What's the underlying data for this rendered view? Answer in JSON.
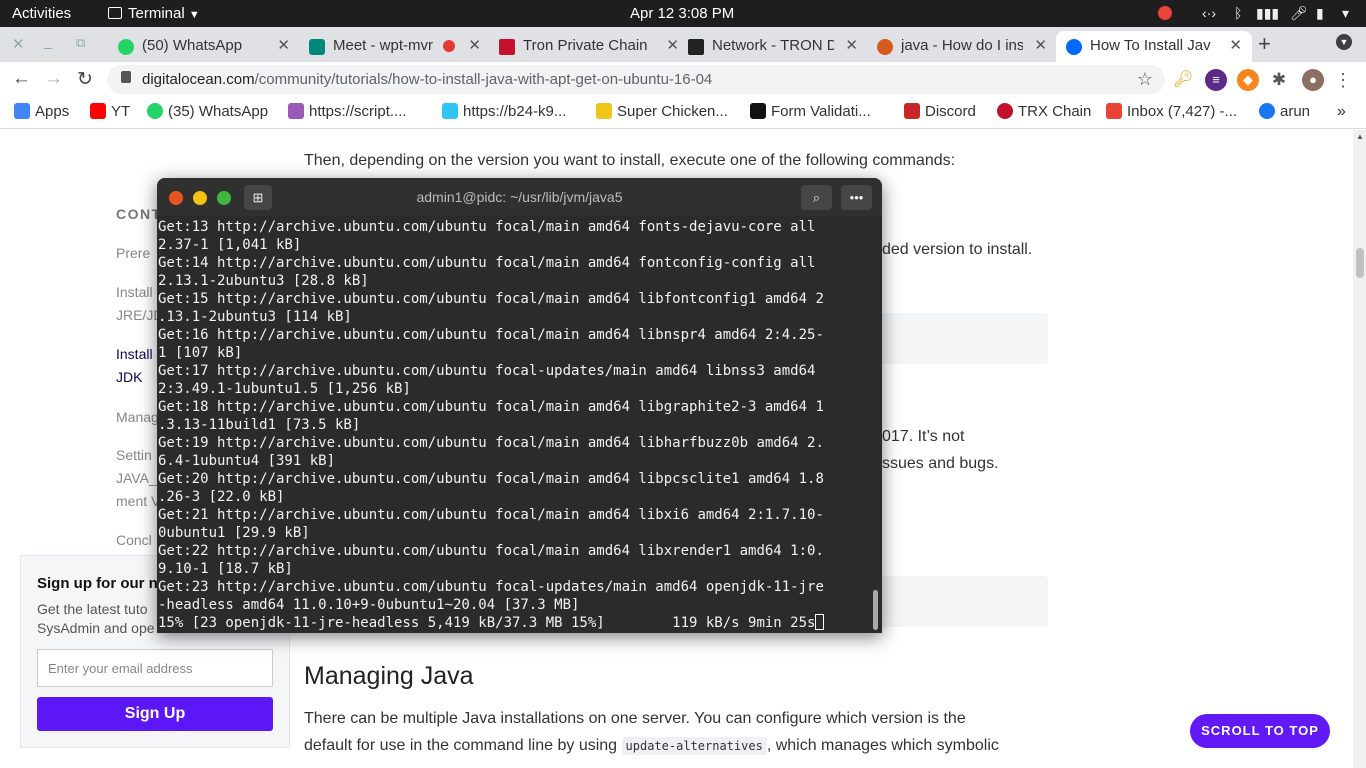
{
  "topbar": {
    "activities": "Activities",
    "app_menu": "Terminal",
    "clock": "Apr 12  3:08 PM"
  },
  "tabs": [
    {
      "title": "(50) WhatsApp",
      "color": "#25d366"
    },
    {
      "title": "Meet - wpt-mvr",
      "color": "#00897b"
    },
    {
      "title": "Tron Private Chain",
      "color": "#c3112d"
    },
    {
      "title": "Network - TRON D",
      "color": "#222222"
    },
    {
      "title": "java - How do I inst",
      "color": "#d65b1d"
    },
    {
      "title": "How To Install Jav",
      "color": "#0069ff"
    }
  ],
  "toolbar": {
    "url_domain": "digitalocean.com",
    "url_path": "/community/tutorials/how-to-install-java-with-apt-get-on-ubuntu-16-04"
  },
  "bookmarks": [
    {
      "label": "Apps",
      "color": "#4285f4"
    },
    {
      "label": "YT",
      "color": "#ff0000"
    },
    {
      "label": "(35) WhatsApp",
      "color": "#25d366"
    },
    {
      "label": "https://script....",
      "color": "#9b59b6"
    },
    {
      "label": "https://b24-k9...",
      "color": "#2fc6f6"
    },
    {
      "label": "Super Chicken...",
      "color": "#f0c419"
    },
    {
      "label": "Form Validati...",
      "color": "#111111"
    },
    {
      "label": "Discord",
      "color": "#7289da"
    },
    {
      "label": "TRX Chain",
      "color": "#c3112d"
    },
    {
      "label": "Inbox (7,427) -...",
      "color": "#ea4335"
    },
    {
      "label": "arun",
      "color": "#1877f2"
    }
  ],
  "page": {
    "intro": "Then, depending on the version you want to install, execute one of the following commands:",
    "frag1": "ded version to install.",
    "frag2": "017. It’s not",
    "frag3": "ssues and bugs.",
    "heading": "Managing Java",
    "para_line1": "There can be multiple Java installations on one server. You can configure which version is the",
    "para_line2a": "default for use in the command line by using",
    "para_code": "update-alternatives",
    "para_line2b": ", which manages which symbolic"
  },
  "sidebar": {
    "contents_label": "CONT",
    "items": [
      "Prere",
      "Install",
      "JRE/JD",
      "Install",
      "JDK",
      "Manag",
      "Settin",
      "JAVA_",
      "ment V",
      "Concl"
    ]
  },
  "signup": {
    "title": "Sign up for our n",
    "desc1": "Get the latest tuto",
    "desc2": "SysAdmin and ope",
    "email_placeholder": "Enter your email address",
    "button": "Sign Up"
  },
  "scroll_top": "SCROLL TO TOP",
  "terminal": {
    "title": "admin1@pidc: ~/usr/lib/jvm/java5",
    "lines": [
      "Get:13 http://archive.ubuntu.com/ubuntu focal/main amd64 fonts-dejavu-core all",
      "2.37-1 [1,041 kB]",
      "Get:14 http://archive.ubuntu.com/ubuntu focal/main amd64 fontconfig-config all",
      "2.13.1-2ubuntu3 [28.8 kB]",
      "Get:15 http://archive.ubuntu.com/ubuntu focal/main amd64 libfontconfig1 amd64 2",
      ".13.1-2ubuntu3 [114 kB]",
      "Get:16 http://archive.ubuntu.com/ubuntu focal/main amd64 libnspr4 amd64 2:4.25-",
      "1 [107 kB]",
      "Get:17 http://archive.ubuntu.com/ubuntu focal-updates/main amd64 libnss3 amd64",
      "2:3.49.1-1ubuntu1.5 [1,256 kB]",
      "Get:18 http://archive.ubuntu.com/ubuntu focal/main amd64 libgraphite2-3 amd64 1",
      ".3.13-11build1 [73.5 kB]",
      "Get:19 http://archive.ubuntu.com/ubuntu focal/main amd64 libharfbuzz0b amd64 2.",
      "6.4-1ubuntu4 [391 kB]",
      "Get:20 http://archive.ubuntu.com/ubuntu focal/main amd64 libpcsclite1 amd64 1.8",
      ".26-3 [22.0 kB]",
      "Get:21 http://archive.ubuntu.com/ubuntu focal/main amd64 libxi6 amd64 2:1.7.10-",
      "0ubuntu1 [29.9 kB]",
      "Get:22 http://archive.ubuntu.com/ubuntu focal/main amd64 libxrender1 amd64 1:0.",
      "9.10-1 [18.7 kB]",
      "Get:23 http://archive.ubuntu.com/ubuntu focal-updates/main amd64 openjdk-11-jre",
      "-headless amd64 11.0.10+9-0ubuntu1~20.04 [37.3 MB]"
    ],
    "progress_line": "15% [23 openjdk-11-jre-headless 5,419 kB/37.3 MB 15%]        119 kB/s 9min 25s"
  }
}
